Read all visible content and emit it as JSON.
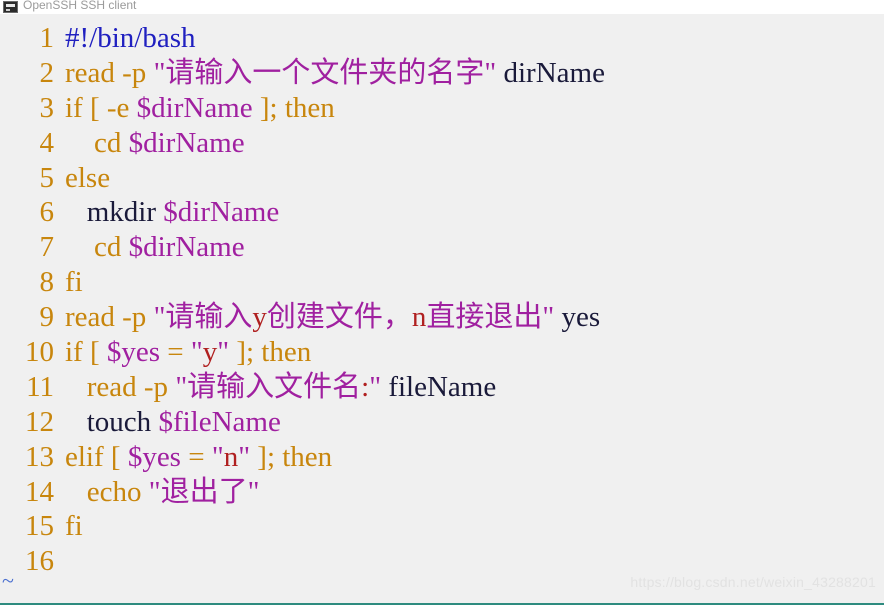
{
  "window": {
    "title": "OpenSSH SSH client",
    "icon": "console-icon",
    "background_color": "#f0f0f0",
    "bottom_border_color": "#2e8b7f"
  },
  "editor": {
    "empty_line_marker": "~",
    "gutter_color": "#c8860d",
    "lines": [
      {
        "number": "1",
        "text": "#!/bin/bash",
        "tokens": [
          {
            "t": "#!/bin/bash",
            "c": "blue"
          }
        ]
      },
      {
        "number": "2",
        "text": "read -p \"请输入一个文件夹的名字\" dirName",
        "tokens": [
          {
            "t": "read -p ",
            "c": "kw"
          },
          {
            "t": "\"请输入一个文件夹的名字\"",
            "c": "str"
          },
          {
            "t": " dirName",
            "c": "plain"
          }
        ]
      },
      {
        "number": "3",
        "text": "if [ -e $dirName ]; then",
        "tokens": [
          {
            "t": "if [ -e ",
            "c": "kw"
          },
          {
            "t": "$dirName",
            "c": "var"
          },
          {
            "t": " ]; then",
            "c": "kw"
          }
        ]
      },
      {
        "number": "4",
        "text": "    cd $dirName",
        "tokens": [
          {
            "t": "    cd ",
            "c": "kw"
          },
          {
            "t": "$dirName",
            "c": "var"
          }
        ]
      },
      {
        "number": "5",
        "text": "else",
        "tokens": [
          {
            "t": "else",
            "c": "kw"
          }
        ]
      },
      {
        "number": "6",
        "text": "   mkdir $dirName",
        "tokens": [
          {
            "t": "   mkdir ",
            "c": "plain"
          },
          {
            "t": "$dirName",
            "c": "var"
          }
        ]
      },
      {
        "number": "7",
        "text": "    cd $dirName",
        "tokens": [
          {
            "t": "    cd ",
            "c": "kw"
          },
          {
            "t": "$dirName",
            "c": "var"
          }
        ]
      },
      {
        "number": "8",
        "text": "fi",
        "tokens": [
          {
            "t": "fi",
            "c": "kw"
          }
        ]
      },
      {
        "number": "9",
        "text": "read -p \"请输入y创建文件，n直接退出\" yes",
        "tokens": [
          {
            "t": "read -p ",
            "c": "kw"
          },
          {
            "t": "\"请输入",
            "c": "str"
          },
          {
            "t": "y",
            "c": "red"
          },
          {
            "t": "创建文件，",
            "c": "str"
          },
          {
            "t": "n",
            "c": "red"
          },
          {
            "t": "直接退出\"",
            "c": "str"
          },
          {
            "t": " yes",
            "c": "plain"
          }
        ]
      },
      {
        "number": "10",
        "text": "if [ $yes = \"y\" ]; then",
        "tokens": [
          {
            "t": "if [ ",
            "c": "kw"
          },
          {
            "t": "$yes",
            "c": "var"
          },
          {
            "t": " = ",
            "c": "kw"
          },
          {
            "t": "\"",
            "c": "str"
          },
          {
            "t": "y",
            "c": "red"
          },
          {
            "t": "\"",
            "c": "str"
          },
          {
            "t": " ]; then",
            "c": "kw"
          }
        ]
      },
      {
        "number": "11",
        "text": "   read -p \"请输入文件名:\" fileName",
        "tokens": [
          {
            "t": "   read -p ",
            "c": "kw"
          },
          {
            "t": "\"请输入文件名",
            "c": "str"
          },
          {
            "t": ":",
            "c": "red"
          },
          {
            "t": "\"",
            "c": "str"
          },
          {
            "t": " fileName",
            "c": "plain"
          }
        ]
      },
      {
        "number": "12",
        "text": "   touch $fileName",
        "tokens": [
          {
            "t": "   touch ",
            "c": "plain"
          },
          {
            "t": "$fileName",
            "c": "var"
          }
        ]
      },
      {
        "number": "13",
        "text": "elif [ $yes = \"n\" ]; then",
        "tokens": [
          {
            "t": "elif [ ",
            "c": "kw"
          },
          {
            "t": "$yes",
            "c": "var"
          },
          {
            "t": " = ",
            "c": "kw"
          },
          {
            "t": "\"",
            "c": "str"
          },
          {
            "t": "n",
            "c": "red"
          },
          {
            "t": "\"",
            "c": "str"
          },
          {
            "t": " ]; then",
            "c": "kw"
          }
        ]
      },
      {
        "number": "14",
        "text": "   echo \"退出了\"",
        "tokens": [
          {
            "t": "   echo ",
            "c": "kw"
          },
          {
            "t": "\"退出了\"",
            "c": "str"
          }
        ]
      },
      {
        "number": "15",
        "text": "fi",
        "tokens": [
          {
            "t": "fi",
            "c": "kw"
          }
        ]
      },
      {
        "number": "16",
        "text": "",
        "tokens": []
      }
    ]
  },
  "watermark": {
    "text": "https://blog.csdn.net/weixin_43288201"
  }
}
